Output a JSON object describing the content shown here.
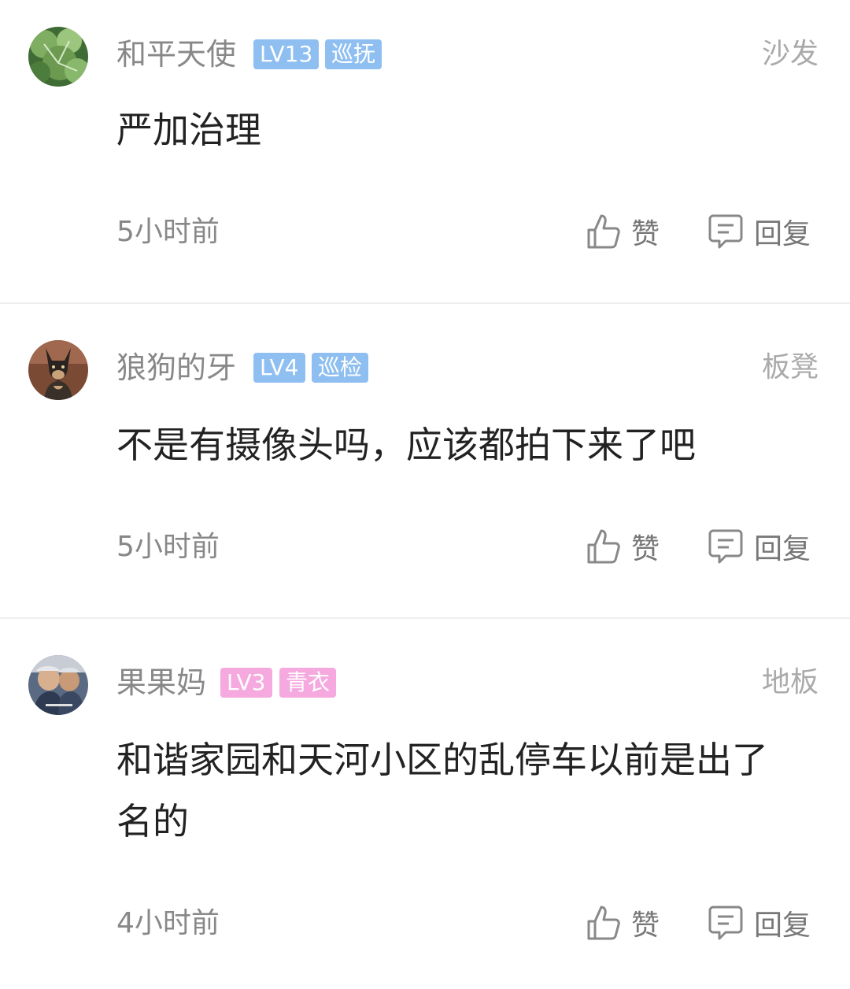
{
  "labels": {
    "like": "赞",
    "reply": "回复"
  },
  "colors": {
    "badge_blue_level": "#8fbff0",
    "badge_blue_role": "#8fbff0",
    "badge_pink": "#f5a9de"
  },
  "comments": [
    {
      "username": "和平天使",
      "level": "LV13",
      "role": "巡抚",
      "floor": "沙发",
      "content": "严加治理",
      "time": "5小时前",
      "avatar_icon": "leaf-avatar"
    },
    {
      "username": "狼狗的牙",
      "level": "LV4",
      "role": "巡检",
      "floor": "板凳",
      "content": "不是有摄像头吗，应该都拍下来了吧",
      "time": "5小时前",
      "avatar_icon": "dog-avatar"
    },
    {
      "username": "果果妈",
      "level": "LV3",
      "role": "青衣",
      "floor": "地板",
      "content": "和谐家园和天河小区的乱停车以前是出了名的",
      "time": "4小时前",
      "avatar_icon": "people-avatar"
    }
  ]
}
